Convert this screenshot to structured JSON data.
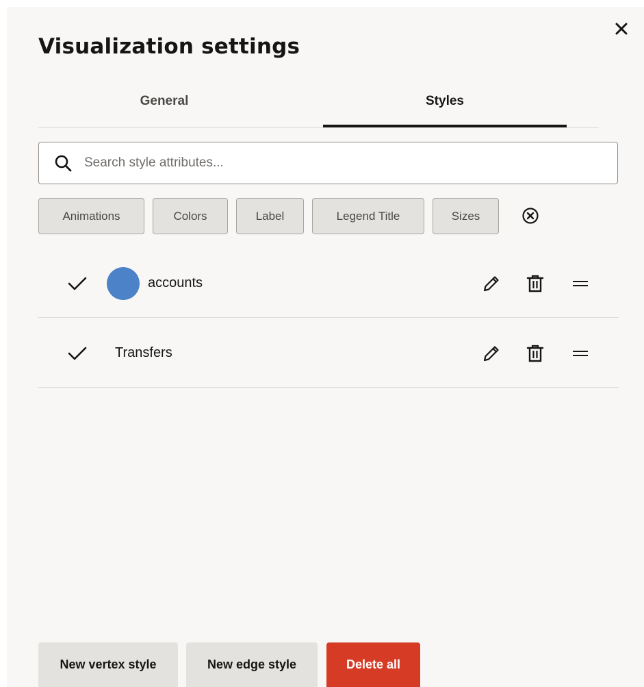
{
  "dialog": {
    "title": "Visualization settings"
  },
  "tabs": [
    {
      "label": "General",
      "selected": false
    },
    {
      "label": "Styles",
      "selected": true
    }
  ],
  "search": {
    "placeholder": "Search style attributes...",
    "value": ""
  },
  "filter_chips": [
    {
      "label": "Animations"
    },
    {
      "label": "Colors"
    },
    {
      "label": "Label"
    },
    {
      "label": "Legend Title"
    },
    {
      "label": "Sizes"
    }
  ],
  "styles": [
    {
      "label": "accounts",
      "enabled": true,
      "swatch_color": "#4c82c8",
      "icon": "circle-swatch"
    },
    {
      "label": "Transfers",
      "enabled": true,
      "swatch_color": null
    }
  ],
  "footer": {
    "new_vertex_label": "New vertex style",
    "new_edge_label": "New edge style",
    "delete_all_label": "Delete all"
  },
  "colors": {
    "danger": "#d63b25",
    "accent_blue": "#4c82c8",
    "panel_bg": "#f9f7f6",
    "chip_bg": "#e4e2df"
  }
}
